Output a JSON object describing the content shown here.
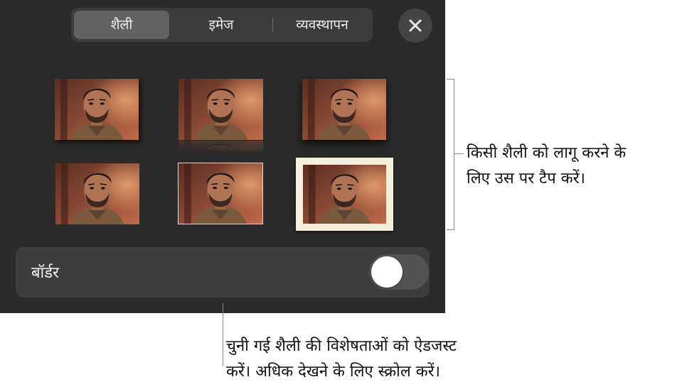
{
  "tabs": [
    {
      "label": "शैली",
      "active": true
    },
    {
      "label": "इमेज",
      "active": false
    },
    {
      "label": "व्यवस्थापन",
      "active": false
    }
  ],
  "close_icon": "close-icon",
  "styles": [
    {
      "name": "plain-shadow"
    },
    {
      "name": "reflection"
    },
    {
      "name": "drop-shadow"
    },
    {
      "name": "plain"
    },
    {
      "name": "thin-white-border"
    },
    {
      "name": "cream-frame"
    }
  ],
  "border_row": {
    "label": "बॉर्डर",
    "toggle_on": false
  },
  "callouts": {
    "right_line1": "किसी शैली को लागू करने के",
    "right_line2": "लिए उस पर टैप करें।",
    "bottom_line1": "चुनी गई शैली की विशेषताओं को ऐडजस्ट",
    "bottom_line2": "करें। अधिक देखने के लिए स्क्रोल करें।"
  },
  "colors": {
    "panel": "#2a2a2a",
    "segment_bg": "#3c3c3c",
    "segment_active": "#626262",
    "row_bg": "#3d3d3d",
    "frame_cream": "#f4efdc"
  }
}
